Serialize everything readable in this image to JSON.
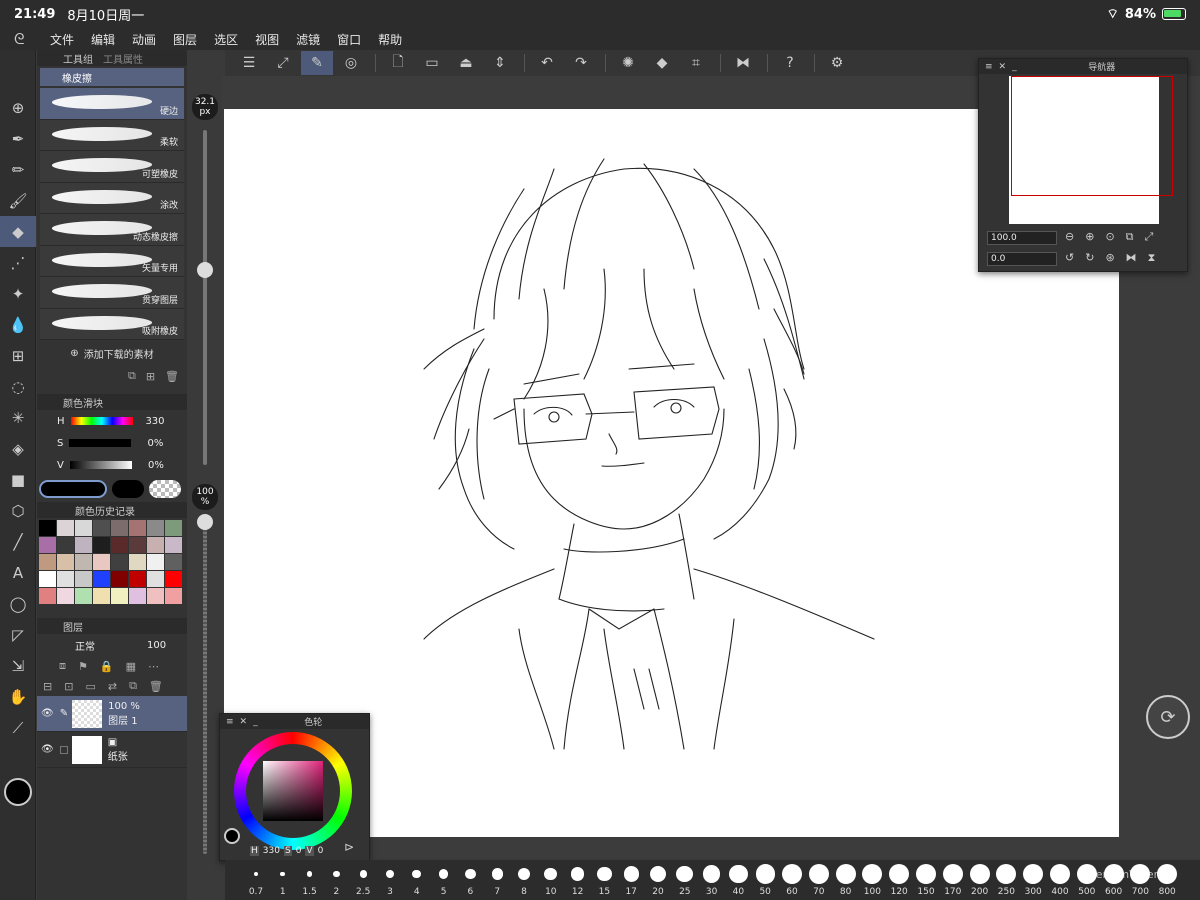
{
  "status": {
    "time": "21:49",
    "date": "8月10日周一",
    "battery": "84%"
  },
  "menu": [
    "文件",
    "编辑",
    "动画",
    "图层",
    "选区",
    "视图",
    "滤镜",
    "窗口",
    "帮助"
  ],
  "toolbar_icons": [
    "menu-icon",
    "new-canvas-icon",
    "edit-icon",
    "spiral-icon",
    "new-file-icon",
    "open-folder-icon",
    "save-icon",
    "sort-icon",
    "undo-icon",
    "redo-icon",
    "loading-icon",
    "fill-icon",
    "transform-icon",
    "flip-icon",
    "help-icon",
    "settings-icon"
  ],
  "tool_group": {
    "tab1": "工具组",
    "tab2": "工具属性",
    "current_tool": "橡皮擦",
    "brushes": [
      "硬边",
      "柔软",
      "可塑橡皮",
      "涂改",
      "动态橡皮擦",
      "矢量专用",
      "贯穿图层",
      "吸附橡皮"
    ],
    "add_material": "添加下载的素材"
  },
  "color_slider": {
    "title": "颜色滑块",
    "h_label": "H",
    "h_value": "330",
    "s_label": "S",
    "s_value": "0%",
    "v_label": "V",
    "v_value": "0%",
    "mode_rg": "RG",
    "mode_hsv": "HSV"
  },
  "color_history": {
    "title": "颜色历史记录"
  },
  "palette_colors": [
    "#000000",
    "#dcd3d6",
    "#d8d8d8",
    "#4f4f4f",
    "#7d6c6c",
    "#a67373",
    "#8a8a8a",
    "#7d9a7a",
    "#a86ea8",
    "#3a3a3a",
    "#c0b3c0",
    "#1e1e1e",
    "#5a2a2a",
    "#5a3a3a",
    "#c9b0b0",
    "#c8b8c8",
    "#c09a80",
    "#d8c0a8",
    "#c0b8b0",
    "#e8c8c0",
    "#404040",
    "#e0d8c0",
    "#f0f0f0",
    "#606060",
    "#ffffff",
    "#e0e0e0",
    "#c8c8c8",
    "#2040ff",
    "#800000",
    "#c00000",
    "#e0e0e0",
    "#ff0000",
    "#e08080",
    "#f0d8e0",
    "#b0e0b0",
    "#f0e0b0",
    "#f0f0c0",
    "#e0c0e0",
    "#f0c0c0",
    "#f0a0a0"
  ],
  "layers": {
    "title": "图层",
    "blend_mode": "正常",
    "opacity": "100",
    "items": [
      {
        "opacity": "100 %",
        "name": "图层 1"
      },
      {
        "opacity": "",
        "name": "纸张"
      }
    ]
  },
  "brush_size_badge": "32.1 px",
  "opacity_badge": "100 %",
  "navigator": {
    "title": "导航器",
    "zoom": "100.0",
    "rotation": "0.0"
  },
  "color_wheel": {
    "title": "色轮",
    "h": "330",
    "s": "0",
    "v": "0",
    "h_label": "H",
    "s_label": "S",
    "v_label": "V"
  },
  "size_bar": [
    "0.7",
    "1",
    "1.5",
    "2",
    "2.5",
    "3",
    "4",
    "5",
    "6",
    "7",
    "8",
    "10",
    "12",
    "15",
    "17",
    "20",
    "25",
    "30",
    "40",
    "50",
    "60",
    "70",
    "80",
    "100",
    "120",
    "150",
    "170",
    "200",
    "250",
    "300",
    "400",
    "500",
    "600",
    "700",
    "800"
  ],
  "watermark": "FerrumWhereR"
}
